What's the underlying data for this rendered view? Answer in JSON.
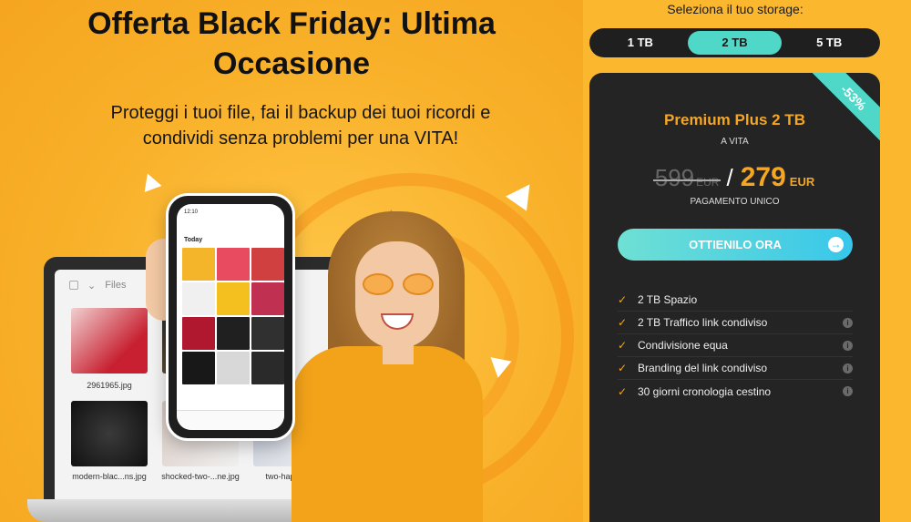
{
  "hero": {
    "title_line1": "Offerta Black Friday: Ultima",
    "title_line2": "Occasione",
    "subtitle_line1": "Proteggi i tuoi file, fai il backup dei tuoi ricordi e",
    "subtitle_line2": "condividi senza problemi per una VITA!"
  },
  "laptop": {
    "folder_label": "Files",
    "files": [
      "2961965.jpg",
      "modern-blac...ns.jpg",
      "shocked-two-...ne.jpg",
      "two-happy-g..."
    ]
  },
  "phone": {
    "time": "12:10",
    "section": "Today"
  },
  "storage": {
    "label": "Seleziona il tuo storage:",
    "options": [
      "1 TB",
      "2 TB",
      "5 TB"
    ],
    "selected": "2 TB"
  },
  "plan": {
    "discount": "-53%",
    "name": "Premium Plus 2 TB",
    "term": "A VITA",
    "old_price": "599",
    "old_currency": "EUR",
    "separator": "/",
    "new_price": "279",
    "new_currency": "EUR",
    "payment": "PAGAMENTO UNICO",
    "cta": "OTTIENILO ORA",
    "features": [
      {
        "label": "2 TB Spazio",
        "info": false
      },
      {
        "label": "2 TB Traffico link condiviso",
        "info": true
      },
      {
        "label": "Condivisione equa",
        "info": true
      },
      {
        "label": "Branding del link condiviso",
        "info": true
      },
      {
        "label": "30 giorni cronologia cestino",
        "info": true
      }
    ]
  },
  "colors": {
    "accent": "#f5a623",
    "teal": "#4fd8c8",
    "card_bg": "#242424",
    "page_bg": "#fbb72e"
  }
}
